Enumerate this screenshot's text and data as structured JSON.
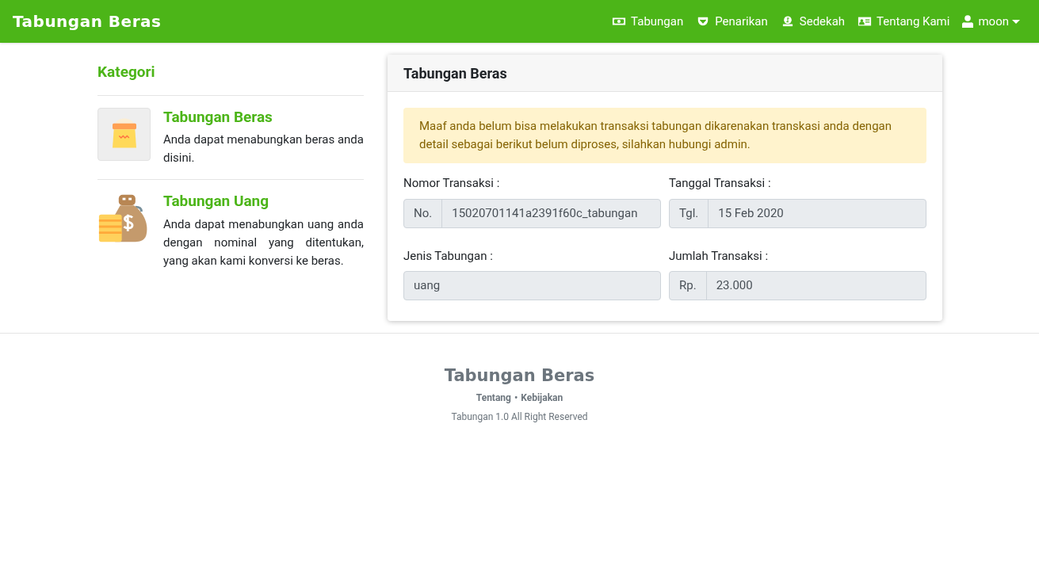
{
  "navbar": {
    "brand": "Tabungan Beras",
    "items": [
      {
        "label": "Tabungan",
        "kind": "money"
      },
      {
        "label": "Penarikan",
        "kind": "pocket"
      },
      {
        "label": "Sedekah",
        "kind": "donate"
      },
      {
        "label": "Tentang Kami",
        "kind": "card"
      },
      {
        "label": "moon",
        "kind": "user"
      }
    ]
  },
  "sidebar": {
    "title": "Kategori",
    "categories": [
      {
        "kind": "rice",
        "title": "Tabungan Beras",
        "description": "Anda dapat menabungkan beras anda disini."
      },
      {
        "kind": "money",
        "title": "Tabungan Uang",
        "description": "Anda dapat menabungkan uang anda dengan nominal yang ditentukan, yang akan kami konversi ke beras."
      }
    ]
  },
  "card": {
    "title": "Tabungan Beras",
    "alert": "Maaf anda belum bisa melakukan transaksi tabungan dikarenakan transkasi anda dengan detail sebagai berikut belum diproses, silahkan hubungi admin.",
    "fields": [
      {
        "label": "Nomor Transaksi :",
        "prefix": "No.",
        "value": "15020701141a2391f60c_tabungan"
      },
      {
        "label": "Tanggal Transaksi :",
        "prefix": "Tgl.",
        "value": "15 Feb 2020"
      },
      {
        "label": "Jenis Tabungan :",
        "value": "uang"
      },
      {
        "label": "Jumlah Transaksi :",
        "prefix": "Rp.",
        "value": "23.000"
      }
    ]
  },
  "footer": {
    "brand": "Tabungan Beras",
    "links": [
      "Tentang",
      "Kebijakan"
    ],
    "separator": "•",
    "copyright": "Tabungan 1.0 All Right Reserved"
  }
}
